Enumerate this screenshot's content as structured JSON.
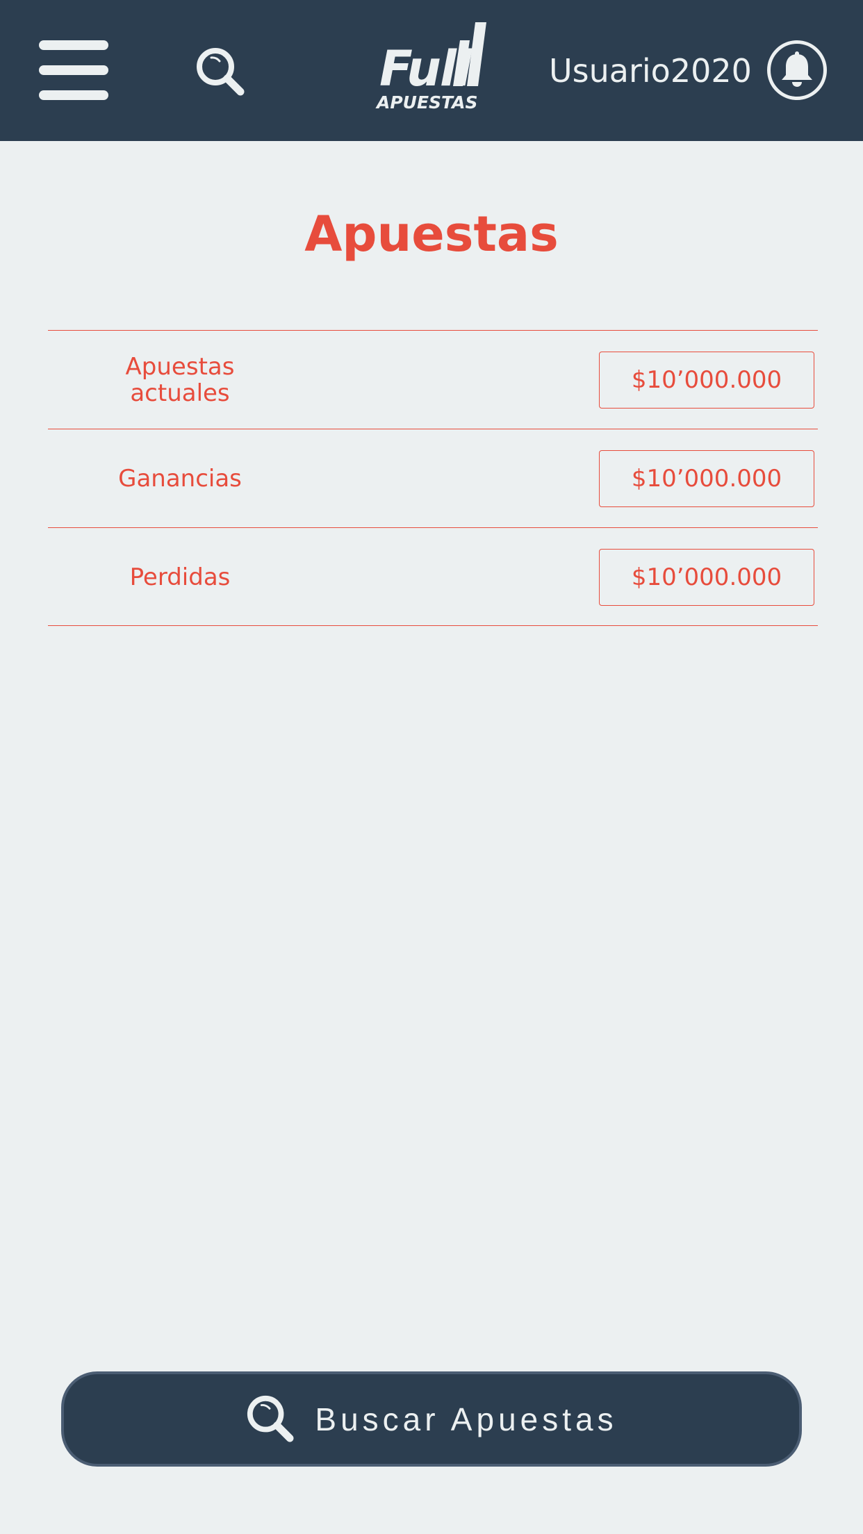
{
  "header": {
    "menu_icon": "hamburger-menu-icon",
    "search_icon": "search-icon",
    "logo": {
      "main": "Full",
      "sub": "APUESTAS"
    },
    "username": "Usuario2020",
    "notification_icon": "bell-icon"
  },
  "page": {
    "title": "Apuestas"
  },
  "stats": [
    {
      "label": "Apuestas actuales",
      "value": "$10’000.000"
    },
    {
      "label": "Ganancias",
      "value": "$10’000.000"
    },
    {
      "label": "Perdidas",
      "value": "$10’000.000"
    }
  ],
  "cta": {
    "icon": "search-icon",
    "label": "Buscar Apuestas"
  },
  "colors": {
    "header_bg": "#2c3e50",
    "page_bg": "#ecf0f1",
    "accent": "#e74c3c",
    "light": "#ecf0f1"
  }
}
